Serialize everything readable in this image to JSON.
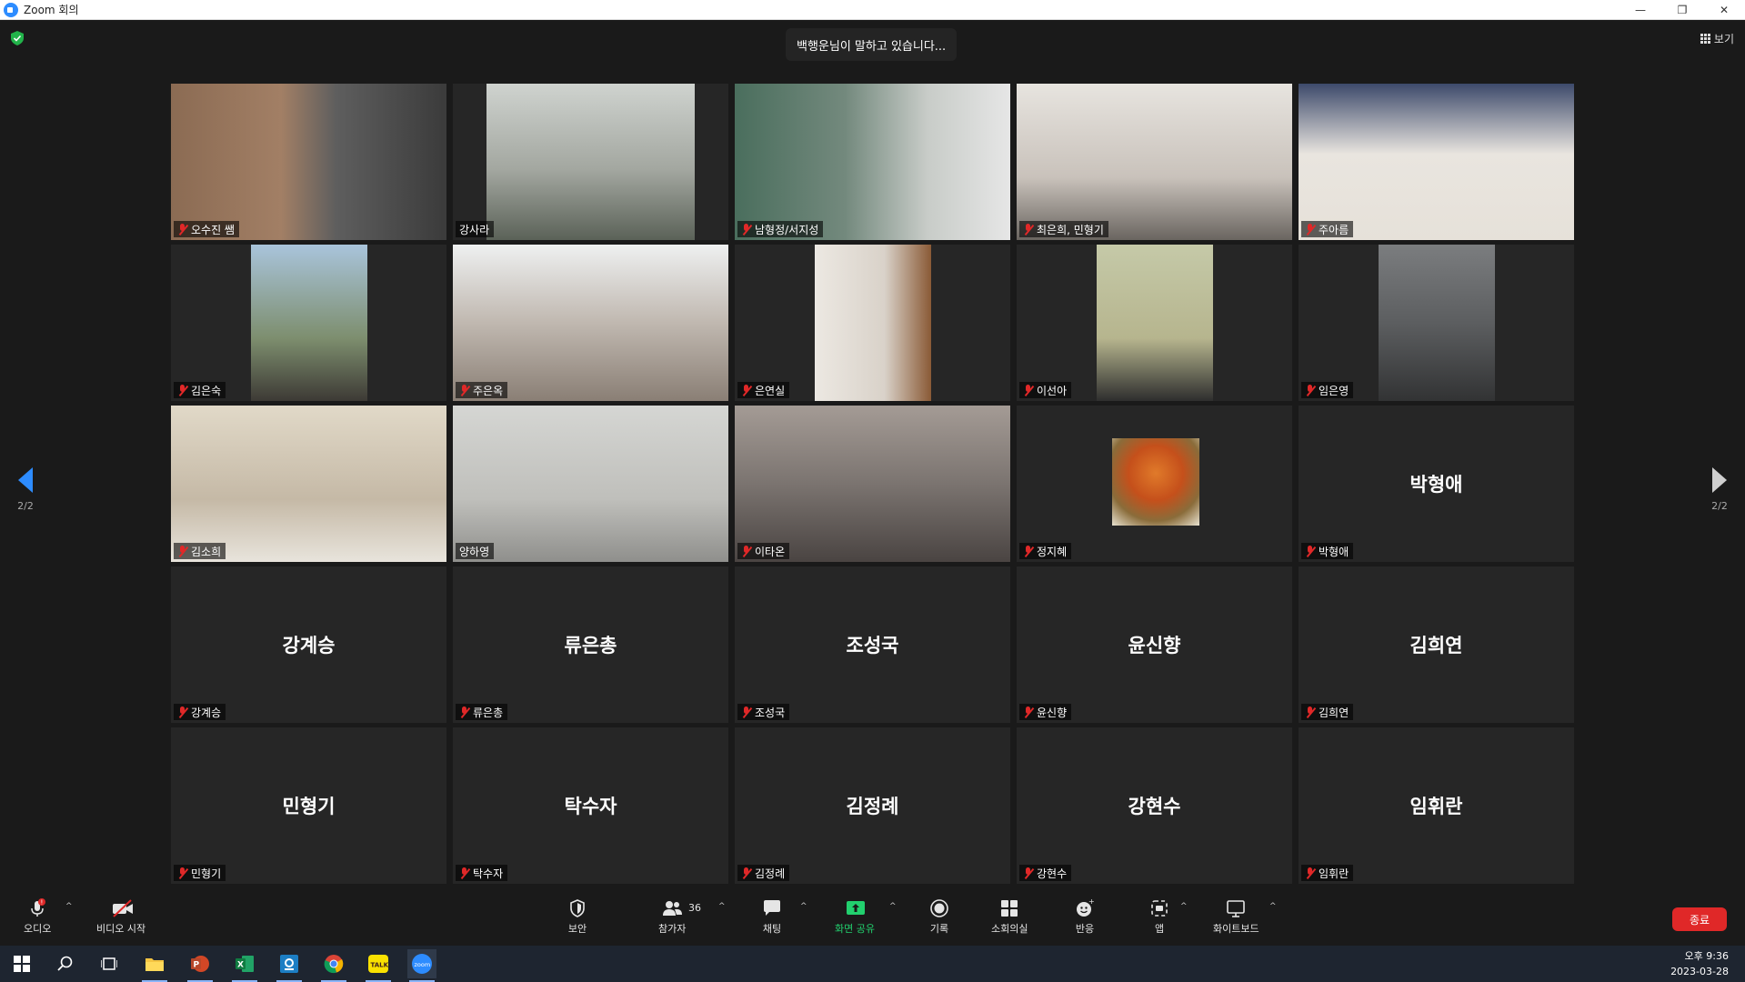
{
  "window": {
    "title": "Zoom 회의",
    "minimize": "—",
    "restore": "❐",
    "close": "✕"
  },
  "header": {
    "speaking_text": "백행운님이 말하고 있습니다...",
    "view_label": "보기"
  },
  "pagination": {
    "left_page": "2/2",
    "right_page": "2/2"
  },
  "tiles": [
    {
      "name": "오수진 쌤",
      "video": true,
      "muted": true
    },
    {
      "name": "강사라",
      "video": true,
      "muted": false
    },
    {
      "name": "남형정/서지성",
      "video": true,
      "muted": true
    },
    {
      "name": "최은희, 민형기",
      "video": true,
      "muted": true
    },
    {
      "name": "주아름",
      "video": true,
      "muted": true
    },
    {
      "name": "김은숙",
      "video": true,
      "muted": true
    },
    {
      "name": "주은옥",
      "video": true,
      "muted": true
    },
    {
      "name": "은연실",
      "video": true,
      "muted": true
    },
    {
      "name": "이선아",
      "video": true,
      "muted": true
    },
    {
      "name": "임은영",
      "video": true,
      "muted": true
    },
    {
      "name": "김소희",
      "video": true,
      "muted": true
    },
    {
      "name": "양하영",
      "video": true,
      "muted": false
    },
    {
      "name": "이타온",
      "video": true,
      "muted": true
    },
    {
      "name": "정지혜",
      "video": false,
      "muted": true,
      "avatar": "tree-photo"
    },
    {
      "name": "박형애",
      "video": false,
      "muted": true,
      "display": "박형애"
    },
    {
      "name": "강계승",
      "video": false,
      "muted": true,
      "display": "강계승"
    },
    {
      "name": "류은총",
      "video": false,
      "muted": true,
      "display": "류은총"
    },
    {
      "name": "조성국",
      "video": false,
      "muted": true,
      "display": "조성국"
    },
    {
      "name": "윤신향",
      "video": false,
      "muted": true,
      "display": "윤신향"
    },
    {
      "name": "김희연",
      "video": false,
      "muted": true,
      "display": "김희연"
    },
    {
      "name": "민형기",
      "video": false,
      "muted": true,
      "display": "민형기"
    },
    {
      "name": "탁수자",
      "video": false,
      "muted": true,
      "display": "탁수자"
    },
    {
      "name": "김정례",
      "video": false,
      "muted": true,
      "display": "김정례"
    },
    {
      "name": "강현수",
      "video": false,
      "muted": true,
      "display": "강현수"
    },
    {
      "name": "임휘란",
      "video": false,
      "muted": true,
      "display": "임휘란"
    }
  ],
  "toolbar": {
    "audio": "오디오",
    "video": "비디오 시작",
    "security": "보안",
    "participants": "참가자",
    "participants_count": "36",
    "chat": "채팅",
    "share": "화면 공유",
    "record": "기록",
    "breakout": "소회의실",
    "reactions": "반응",
    "apps": "앱",
    "whiteboard": "화이트보드",
    "end": "종료"
  },
  "taskbar": {
    "time": "오후 9:36",
    "date": "2023-03-28",
    "kakao_label": "TALK",
    "zoom_label": "zoom"
  },
  "colors": {
    "accent": "#2d8cff",
    "end": "#e02828",
    "share": "#22d06e",
    "muted": "#e02828"
  }
}
